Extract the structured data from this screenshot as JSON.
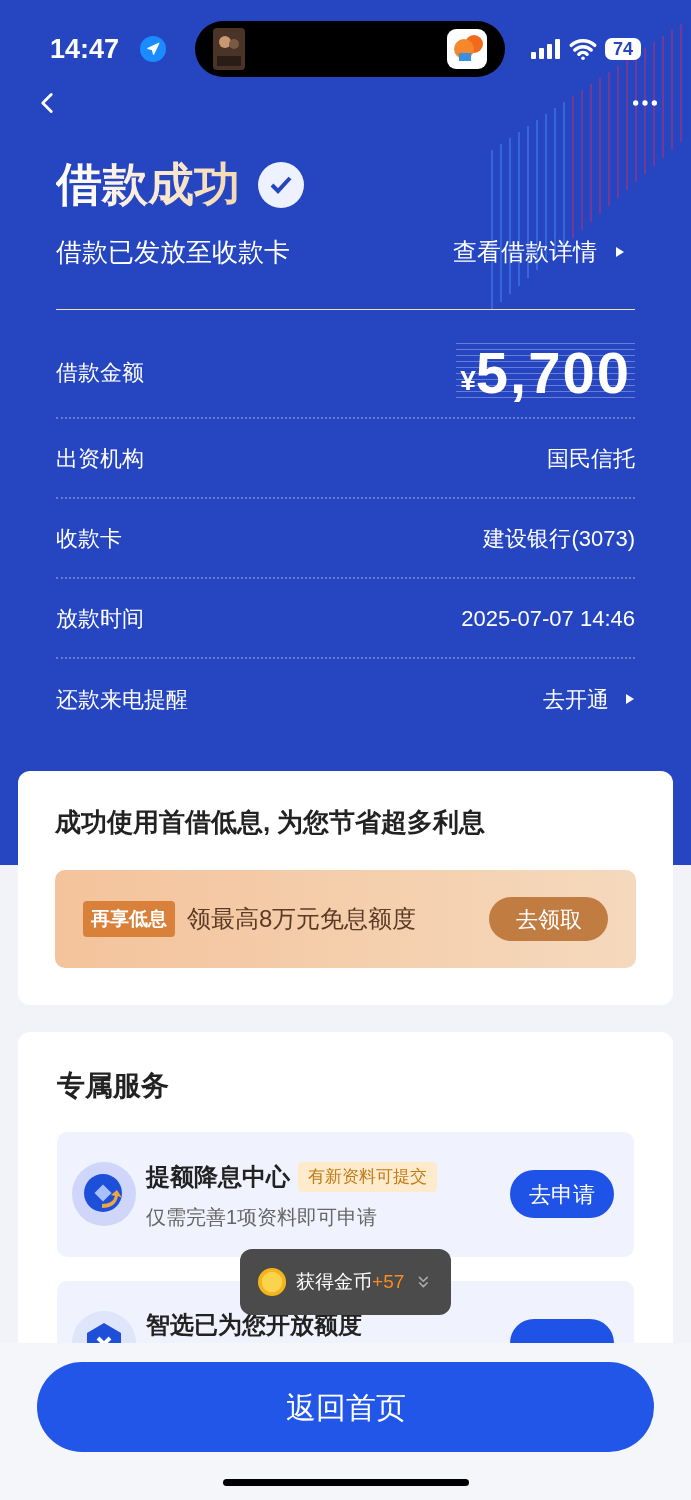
{
  "status_bar": {
    "time": "14:47",
    "battery": "74"
  },
  "header": {
    "title": "借款成功",
    "subtitle": "借款已发放至收款卡",
    "details_link": "查看借款详情"
  },
  "loan": {
    "amount_label": "借款金额",
    "currency": "¥",
    "amount": "5,700"
  },
  "details": [
    {
      "label": "出资机构",
      "value": "国民信托",
      "kind": "text"
    },
    {
      "label": "收款卡",
      "value": "建设银行(3073)",
      "kind": "text"
    },
    {
      "label": "放款时间",
      "value": "2025-07-07 14:46",
      "kind": "text"
    },
    {
      "label": "还款来电提醒",
      "value": "去开通",
      "kind": "link"
    }
  ],
  "promo_card": {
    "title": "成功使用首借低息, 为您节省超多利息",
    "tag": "再享低息",
    "text": "领最高8万元免息额度",
    "button": "去领取"
  },
  "services": {
    "title": "专属服务",
    "items": [
      {
        "kind": "rise",
        "name": "提额降息中心",
        "badge": "有新资料可提交",
        "description": "仅需完善1项资料即可申请",
        "button": "去申请"
      },
      {
        "kind": "shield",
        "name": "智选已为您开放额度"
      }
    ]
  },
  "toast": {
    "text": "获得金币",
    "amount": "+57"
  },
  "primary_button": "返回首页"
}
